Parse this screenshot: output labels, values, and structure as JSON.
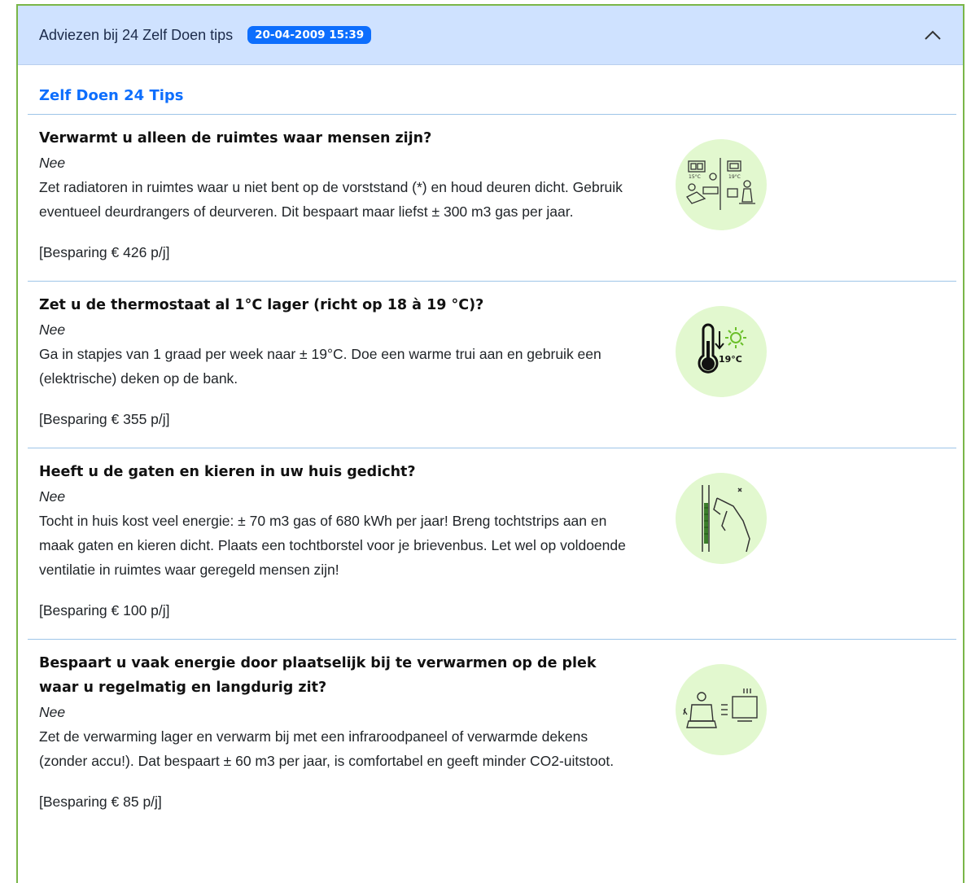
{
  "header": {
    "title": "Adviezen bij 24 Zelf Doen tips",
    "badge": "20-04-2009 15:39"
  },
  "section_title": "Zelf Doen 24 Tips",
  "tips": [
    {
      "question": "Verwarmt u alleen de ruimtes waar mensen zijn?",
      "answer": "Nee",
      "advice": "Zet radiatoren in ruimtes waar u niet bent op de vorststand (*) en houd deuren dicht. Gebruik eventueel deurdrangers of deurveren. Dit bespaart maar liefst ± 300 m3 gas per jaar.",
      "saving": "[Besparing € 426 p/j]",
      "icon": "rooms-heating-icon",
      "icon_labels": [
        "15°C",
        "19°C"
      ]
    },
    {
      "question": "Zet u de thermostaat al 1°C lager (richt op 18 à 19 °C)?",
      "answer": "Nee",
      "advice": "Ga in stapjes van 1 graad per week naar ± 19°C. Doe een warme trui aan en gebruik een (elektrische) deken op de bank.",
      "saving": "[Besparing € 355 p/j]",
      "icon": "thermometer-icon",
      "icon_labels": [
        "19°C"
      ]
    },
    {
      "question": "Heeft u de gaten en kieren in uw huis gedicht?",
      "answer": "Nee",
      "advice": "Tocht in huis kost veel energie: ± 70 m3 gas of 680 kWh per jaar! Breng tochtstrips aan en maak gaten en kieren dicht. Plaats een tochtborstel voor je brievenbus. Let wel op voldoende ventilatie in ruimtes waar geregeld mensen zijn!",
      "saving": "[Besparing € 100 p/j]",
      "icon": "draught-strip-icon"
    },
    {
      "question": "Bespaart u vaak energie door plaatselijk bij te verwarmen op de plek waar u regelmatig en langdurig zit?",
      "answer": "Nee",
      "advice": "Zet de verwarming lager en verwarm bij met een infraroodpaneel of verwarmde dekens (zonder accu!). Dat bespaart ± 60 m3 per jaar, is comfortabel en geeft minder CO2-uitstoot.",
      "saving": "[Besparing € 85 p/j]",
      "icon": "infrared-panel-icon"
    }
  ],
  "colors": {
    "header_bg": "#cfe2ff",
    "badge_bg": "#0d6efd",
    "section_title": "#0d6efd",
    "frame_border": "#7ab648",
    "icon_circle": "#e2f8cf"
  }
}
